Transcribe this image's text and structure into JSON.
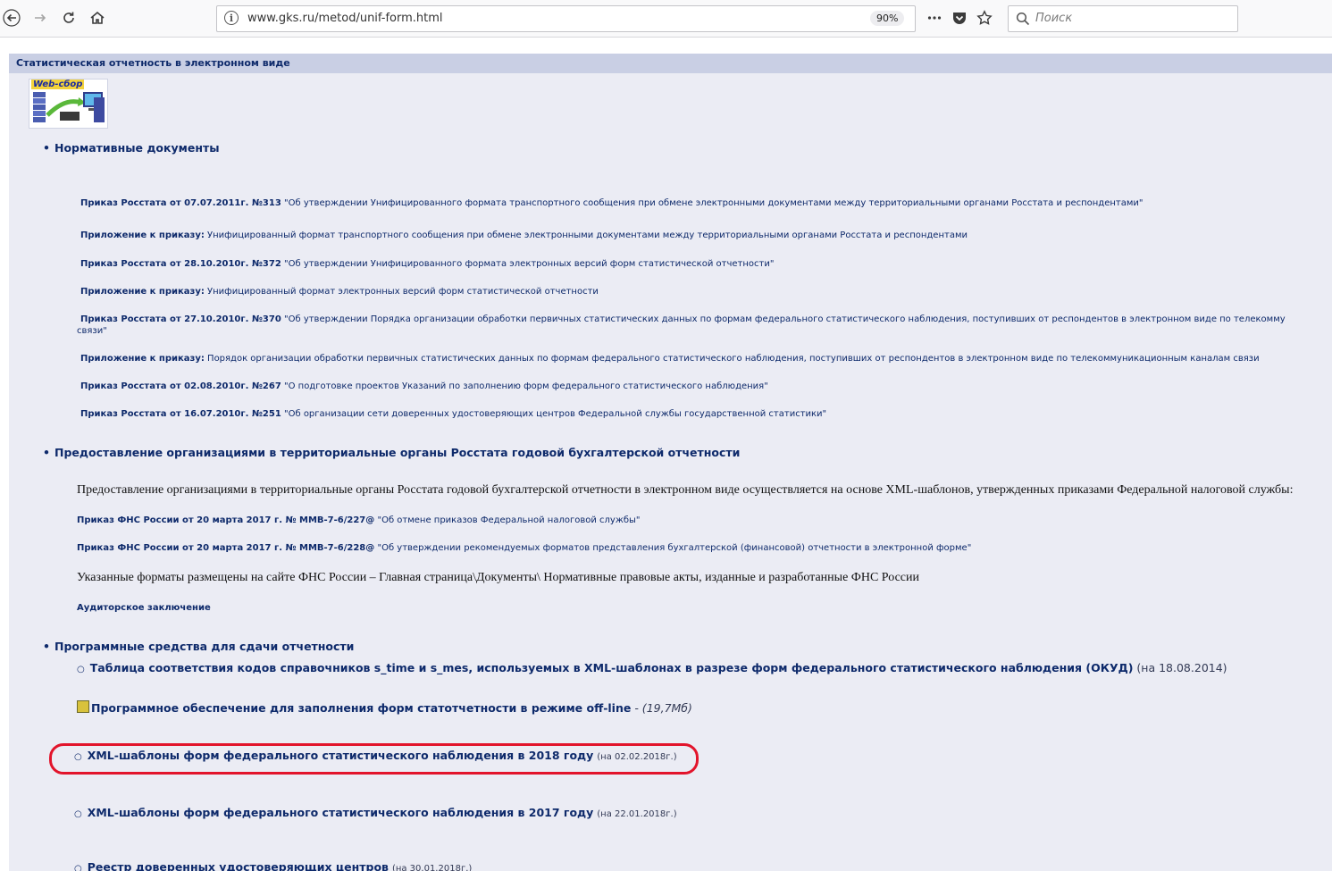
{
  "browser": {
    "url": "www.gks.ru/metod/unif-form.html",
    "zoom": "90%",
    "search_placeholder": "Поиск"
  },
  "page": {
    "header": "Статистическая отчетность в электронном виде",
    "logo_text": "Web-сбор",
    "sections": {
      "normative_title": "Нормативные документы",
      "normative_docs": [
        {
          "title": "Приказ Росстата от 07.07.2011г. №313",
          "text": "\"Об утверждении Унифицированного формата транспортного сообщения при обмене электронными документами между территориальными органами Росстата и респондентами\""
        },
        {
          "title": "Приложение к приказу:",
          "text": "Унифицированный формат транспортного сообщения при обмене электронными документами между территориальными органами Росстата и респондентами"
        },
        {
          "title": "Приказ Росстата от 28.10.2010г. №372",
          "text": "\"Об утверждении Унифицированного формата электронных версий форм статистической отчетности\""
        },
        {
          "title": "Приложение к приказу:",
          "text": "Унифицированный формат электронных версий форм статистической отчетности"
        },
        {
          "title": "Приказ Росстата от 27.10.2010г. №370",
          "text": "\"Об утверждении Порядка организации обработки первичных статистических данных по формам федерального статистического наблюдения, поступивших от респондентов в электронном виде по телекомму",
          "text2": "связи\""
        },
        {
          "title": "Приложение к приказу:",
          "text": "Порядок организации обработки первичных статистических данных по формам федерального статистического наблюдения, поступивших от респондентов в электронном виде по телекоммуникационным каналам связи"
        },
        {
          "title": "Приказ Росстата от 02.08.2010г. №267",
          "text": "\"О подготовке проектов Указаний по заполнению форм федерального статистического наблюдения\""
        },
        {
          "title": "Приказ Росстата от 16.07.2010г. №251",
          "text": "\"Об организации сети доверенных удостоверяющих центров Федеральной службы государственной статистики\""
        }
      ],
      "accounting_title": "Предоставление организациями в территориальные органы Росстата годовой бухгалтерской отчетности",
      "accounting_intro": "Предоставление организациями в территориальные органы Росстата годовой бухгалтерской отчетности в электронном виде осуществляется на основе XML-шаблонов, утвержденных приказами Федеральной налоговой службы:",
      "accounting_docs": [
        {
          "title": "Приказ ФНС России от 20 марта 2017 г. № ММВ-7-6/227@",
          "text": "\"Об отмене приказов Федеральной налоговой службы\""
        },
        {
          "title": "Приказ ФНС России от 20 марта 2017 г. № ММВ-7-6/228@",
          "text": "\"Об утверждении рекомендуемых форматов представления бухгалтерской (финансовой) отчетности в электронной форме\""
        }
      ],
      "accounting_note": "Указанные форматы размещены на сайте ФНС России – Главная страница\\Документы\\ Нормативные правовые акты, изданные и разработанные ФНС России",
      "audit_link": "Аудиторское заключение",
      "software_title": "Программные средства для сдачи отчетности",
      "software_items": [
        {
          "title": "Таблица соответствия кодов справочников s_time и s_mes, используемых в XML-шаблонах в разрезе форм федерального статистического наблюдения (ОКУД)",
          "note": "(на 18.08.2014)"
        },
        {
          "title": "Программное обеспечение для заполнения форм статотчетности в режиме off-line",
          "note": "- (19,7Мб)"
        },
        {
          "title": "XML-шаблоны форм федерального статистического наблюдения в 2018 году",
          "note": "(на 02.02.2018г.)"
        },
        {
          "title": "XML-шаблоны форм федерального статистического наблюдения в 2017 году",
          "note": "(на 22.01.2018г.)"
        },
        {
          "title": "Реестр доверенных удостоверяющих центров",
          "note": "(на 30.01.2018г.)"
        }
      ]
    }
  }
}
